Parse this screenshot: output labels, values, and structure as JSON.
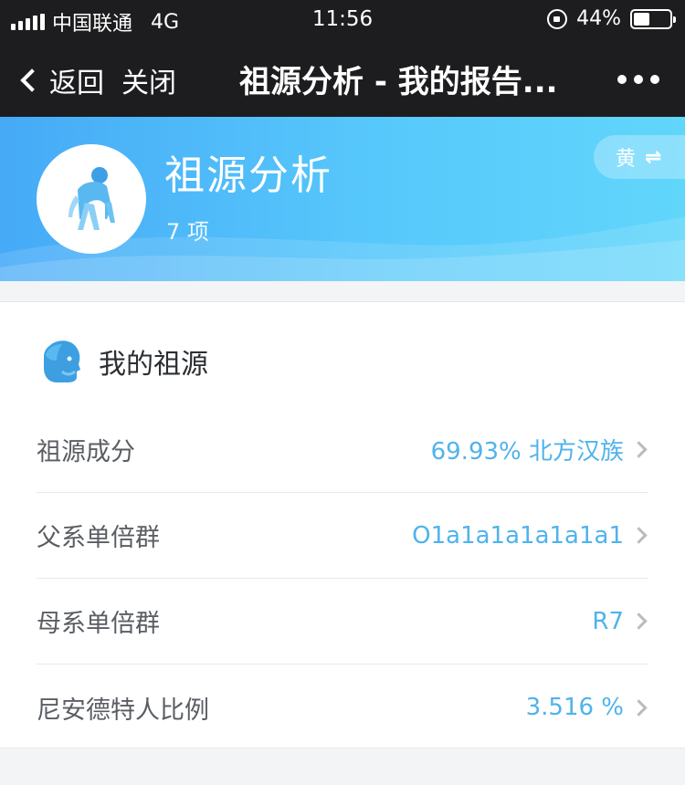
{
  "status_bar": {
    "carrier": "中国联通",
    "network": "4G",
    "time": "11:56",
    "battery_percent": "44%",
    "battery_level": 0.44
  },
  "nav": {
    "back_label": "返回",
    "close_label": "关闭",
    "title": "祖源分析 - 我的报告..."
  },
  "header": {
    "title": "祖源分析",
    "count": "7 项",
    "switch_label": "黄",
    "switch_icon": "⇌",
    "colors": {
      "gradient_start": "#46aaf7",
      "gradient_end": "#61d6fb"
    }
  },
  "card": {
    "title": "我的祖源",
    "rows": [
      {
        "label": "祖源成分",
        "value": "69.93% 北方汉族"
      },
      {
        "label": "父系单倍群",
        "value": "O1a1a1a1a1a1a1"
      },
      {
        "label": "母系单倍群",
        "value": "R7"
      },
      {
        "label": "尼安德特人比例",
        "value": "3.516 %"
      }
    ]
  },
  "colors": {
    "accent": "#4fb3ec",
    "nav_bg": "#1d1d1f"
  }
}
